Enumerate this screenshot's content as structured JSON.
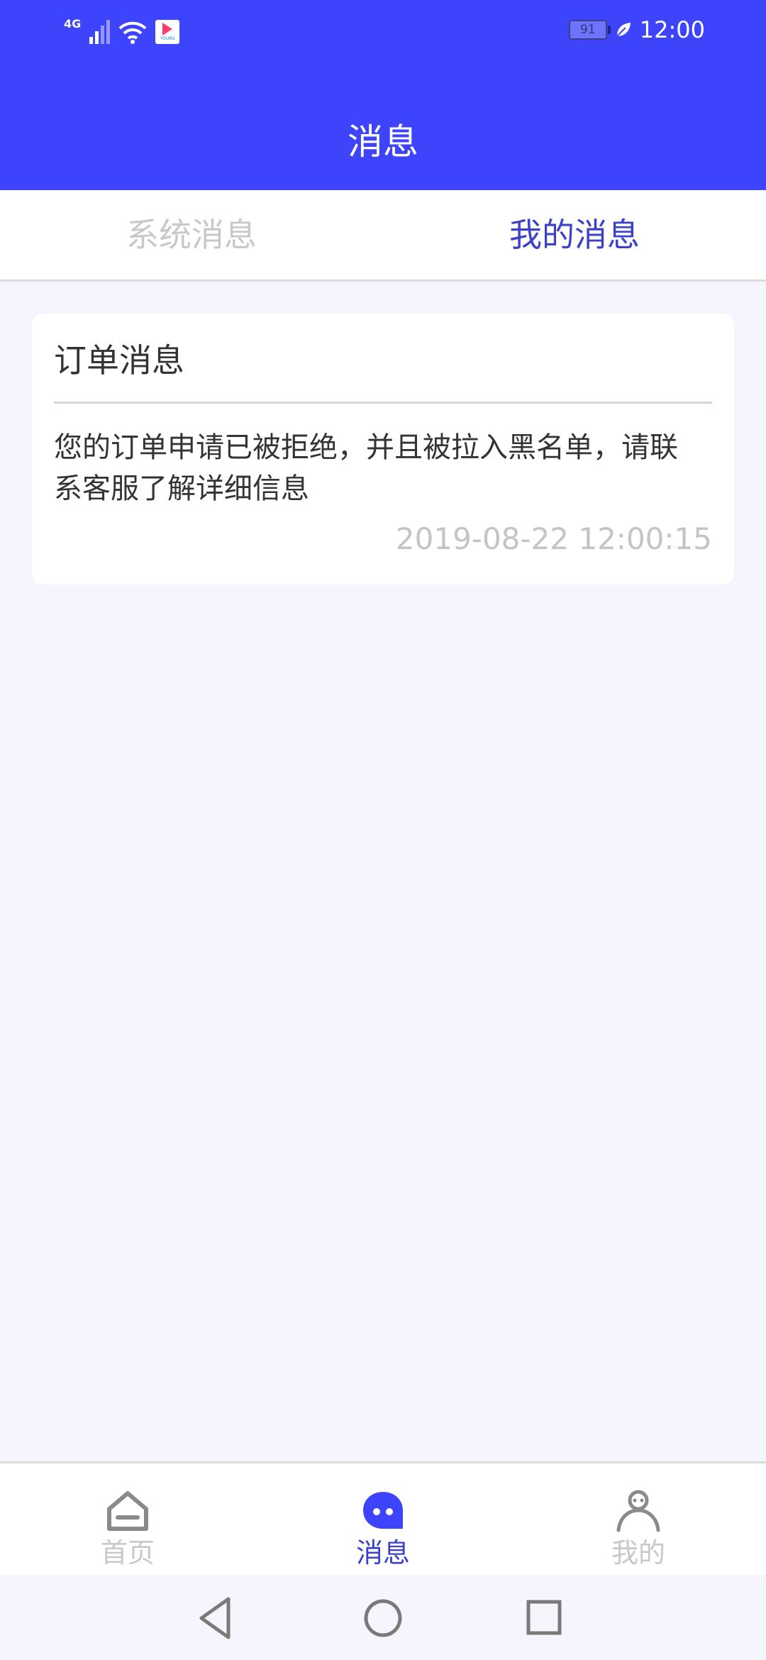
{
  "status_bar": {
    "network": "4G",
    "battery": "91",
    "time": "12:00",
    "app_badge_text": "YOUKU",
    "icons": [
      "signal-icon",
      "wifi-icon",
      "youku-app-icon",
      "battery-icon",
      "leaf-icon"
    ]
  },
  "header": {
    "title": "消息"
  },
  "tabs": [
    {
      "label": "系统消息",
      "active": false
    },
    {
      "label": "我的消息",
      "active": true
    }
  ],
  "messages": [
    {
      "title": "订单消息",
      "body": "您的订单申请已被拒绝，并且被拉入黑名单，请联系客服了解详细信息",
      "time": "2019-08-22 12:00:15"
    }
  ],
  "bottom_nav": [
    {
      "label": "首页",
      "icon": "home-icon",
      "active": false
    },
    {
      "label": "消息",
      "icon": "message-bubble-icon",
      "active": true
    },
    {
      "label": "我的",
      "icon": "person-icon",
      "active": false
    }
  ],
  "system_nav": [
    "back-icon",
    "home-circle-icon",
    "recents-icon"
  ],
  "colors": {
    "primary": "#3e44fb",
    "active_text": "#3d41c8",
    "inactive_text": "#c8c8c8",
    "page_background": "#f5f5fe"
  }
}
